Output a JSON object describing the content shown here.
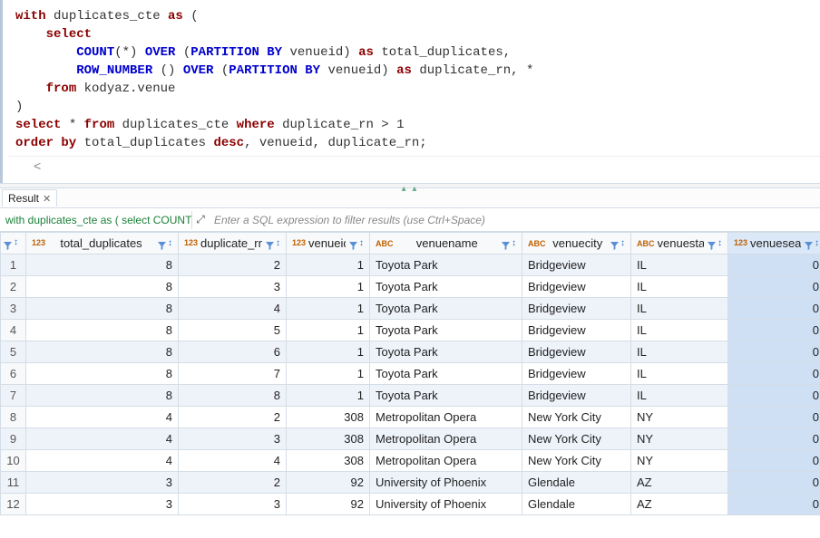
{
  "editor": {
    "lines": [
      {
        "segments": [
          {
            "t": "with",
            "c": "kw"
          },
          {
            "t": " duplicates_cte ",
            "c": "ident"
          },
          {
            "t": "as",
            "c": "kw"
          },
          {
            "t": " (",
            "c": "paren"
          }
        ]
      },
      {
        "segments": [
          {
            "t": "    ",
            "c": ""
          },
          {
            "t": "select",
            "c": "kw"
          }
        ]
      },
      {
        "segments": [
          {
            "t": "        ",
            "c": ""
          },
          {
            "t": "COUNT",
            "c": "blue"
          },
          {
            "t": "(*) ",
            "c": "paren"
          },
          {
            "t": "OVER",
            "c": "blue"
          },
          {
            "t": " (",
            "c": "paren"
          },
          {
            "t": "PARTITION BY",
            "c": "blue"
          },
          {
            "t": " venueid) ",
            "c": "ident"
          },
          {
            "t": "as",
            "c": "kw"
          },
          {
            "t": " total_duplicates,",
            "c": "ident"
          }
        ]
      },
      {
        "segments": [
          {
            "t": "        ",
            "c": ""
          },
          {
            "t": "ROW_NUMBER",
            "c": "blue"
          },
          {
            "t": " () ",
            "c": "paren"
          },
          {
            "t": "OVER",
            "c": "blue"
          },
          {
            "t": " (",
            "c": "paren"
          },
          {
            "t": "PARTITION BY",
            "c": "blue"
          },
          {
            "t": " venueid) ",
            "c": "ident"
          },
          {
            "t": "as",
            "c": "kw"
          },
          {
            "t": " duplicate_rn, *",
            "c": "ident"
          }
        ]
      },
      {
        "segments": [
          {
            "t": "    ",
            "c": ""
          },
          {
            "t": "from",
            "c": "kw"
          },
          {
            "t": " kodyaz.venue",
            "c": "ident"
          }
        ]
      },
      {
        "segments": [
          {
            "t": ")",
            "c": "paren"
          }
        ]
      },
      {
        "segments": [
          {
            "t": "select",
            "c": "kw"
          },
          {
            "t": " * ",
            "c": "ident"
          },
          {
            "t": "from",
            "c": "kw"
          },
          {
            "t": " duplicates_cte ",
            "c": "ident"
          },
          {
            "t": "where",
            "c": "kw"
          },
          {
            "t": " duplicate_rn > 1",
            "c": "ident"
          }
        ]
      },
      {
        "segments": [
          {
            "t": "order by",
            "c": "kw"
          },
          {
            "t": " total_duplicates ",
            "c": "ident"
          },
          {
            "t": "desc",
            "c": "kw"
          },
          {
            "t": ", venueid, duplicate_rn;",
            "c": "ident"
          }
        ]
      }
    ],
    "scroll_left_glyph": "<"
  },
  "resultTab": {
    "label": "Result"
  },
  "filterbar": {
    "sql_echo": "with duplicates_cte as ( select COUNT(*) O",
    "expand_glyph": "⤢",
    "hint": "Enter a SQL expression to filter results (use Ctrl+Space)"
  },
  "columns": [
    {
      "name": "total_duplicates",
      "type": "num",
      "width": 168
    },
    {
      "name": "duplicate_rn",
      "type": "num",
      "width": 119
    },
    {
      "name": "venueid",
      "type": "num",
      "width": 92
    },
    {
      "name": "venuename",
      "type": "abc",
      "width": 168
    },
    {
      "name": "venuecity",
      "type": "abc",
      "width": 120
    },
    {
      "name": "venuestate",
      "type": "abc",
      "width": 107
    },
    {
      "name": "venueseats",
      "type": "num",
      "width": 107,
      "selected": true
    }
  ],
  "rows": [
    {
      "n": 1,
      "total_duplicates": 8,
      "duplicate_rn": 2,
      "venueid": 1,
      "venuename": "Toyota Park",
      "venuecity": "Bridgeview",
      "venuestate": "IL",
      "venueseats": 0
    },
    {
      "n": 2,
      "total_duplicates": 8,
      "duplicate_rn": 3,
      "venueid": 1,
      "venuename": "Toyota Park",
      "venuecity": "Bridgeview",
      "venuestate": "IL",
      "venueseats": 0
    },
    {
      "n": 3,
      "total_duplicates": 8,
      "duplicate_rn": 4,
      "venueid": 1,
      "venuename": "Toyota Park",
      "venuecity": "Bridgeview",
      "venuestate": "IL",
      "venueseats": 0
    },
    {
      "n": 4,
      "total_duplicates": 8,
      "duplicate_rn": 5,
      "venueid": 1,
      "venuename": "Toyota Park",
      "venuecity": "Bridgeview",
      "venuestate": "IL",
      "venueseats": 0
    },
    {
      "n": 5,
      "total_duplicates": 8,
      "duplicate_rn": 6,
      "venueid": 1,
      "venuename": "Toyota Park",
      "venuecity": "Bridgeview",
      "venuestate": "IL",
      "venueseats": 0
    },
    {
      "n": 6,
      "total_duplicates": 8,
      "duplicate_rn": 7,
      "venueid": 1,
      "venuename": "Toyota Park",
      "venuecity": "Bridgeview",
      "venuestate": "IL",
      "venueseats": 0
    },
    {
      "n": 7,
      "total_duplicates": 8,
      "duplicate_rn": 8,
      "venueid": 1,
      "venuename": "Toyota Park",
      "venuecity": "Bridgeview",
      "venuestate": "IL",
      "venueseats": 0
    },
    {
      "n": 8,
      "total_duplicates": 4,
      "duplicate_rn": 2,
      "venueid": 308,
      "venuename": "Metropolitan Opera",
      "venuecity": "New York City",
      "venuestate": "NY",
      "venueseats": 0
    },
    {
      "n": 9,
      "total_duplicates": 4,
      "duplicate_rn": 3,
      "venueid": 308,
      "venuename": "Metropolitan Opera",
      "venuecity": "New York City",
      "venuestate": "NY",
      "venueseats": 0
    },
    {
      "n": 10,
      "total_duplicates": 4,
      "duplicate_rn": 4,
      "venueid": 308,
      "venuename": "Metropolitan Opera",
      "venuecity": "New York City",
      "venuestate": "NY",
      "venueseats": 0
    },
    {
      "n": 11,
      "total_duplicates": 3,
      "duplicate_rn": 2,
      "venueid": 92,
      "venuename": "University of Phoenix",
      "venuecity": "Glendale",
      "venuestate": "AZ",
      "venueseats": 0
    },
    {
      "n": 12,
      "total_duplicates": 3,
      "duplicate_rn": 3,
      "venueid": 92,
      "venuename": "University of Phoenix",
      "venuecity": "Glendale",
      "venuestate": "AZ",
      "venueseats": 0
    }
  ],
  "icons": {
    "num_type_top": "123",
    "abc_type": "ABC",
    "sort_glyph": "↕"
  }
}
